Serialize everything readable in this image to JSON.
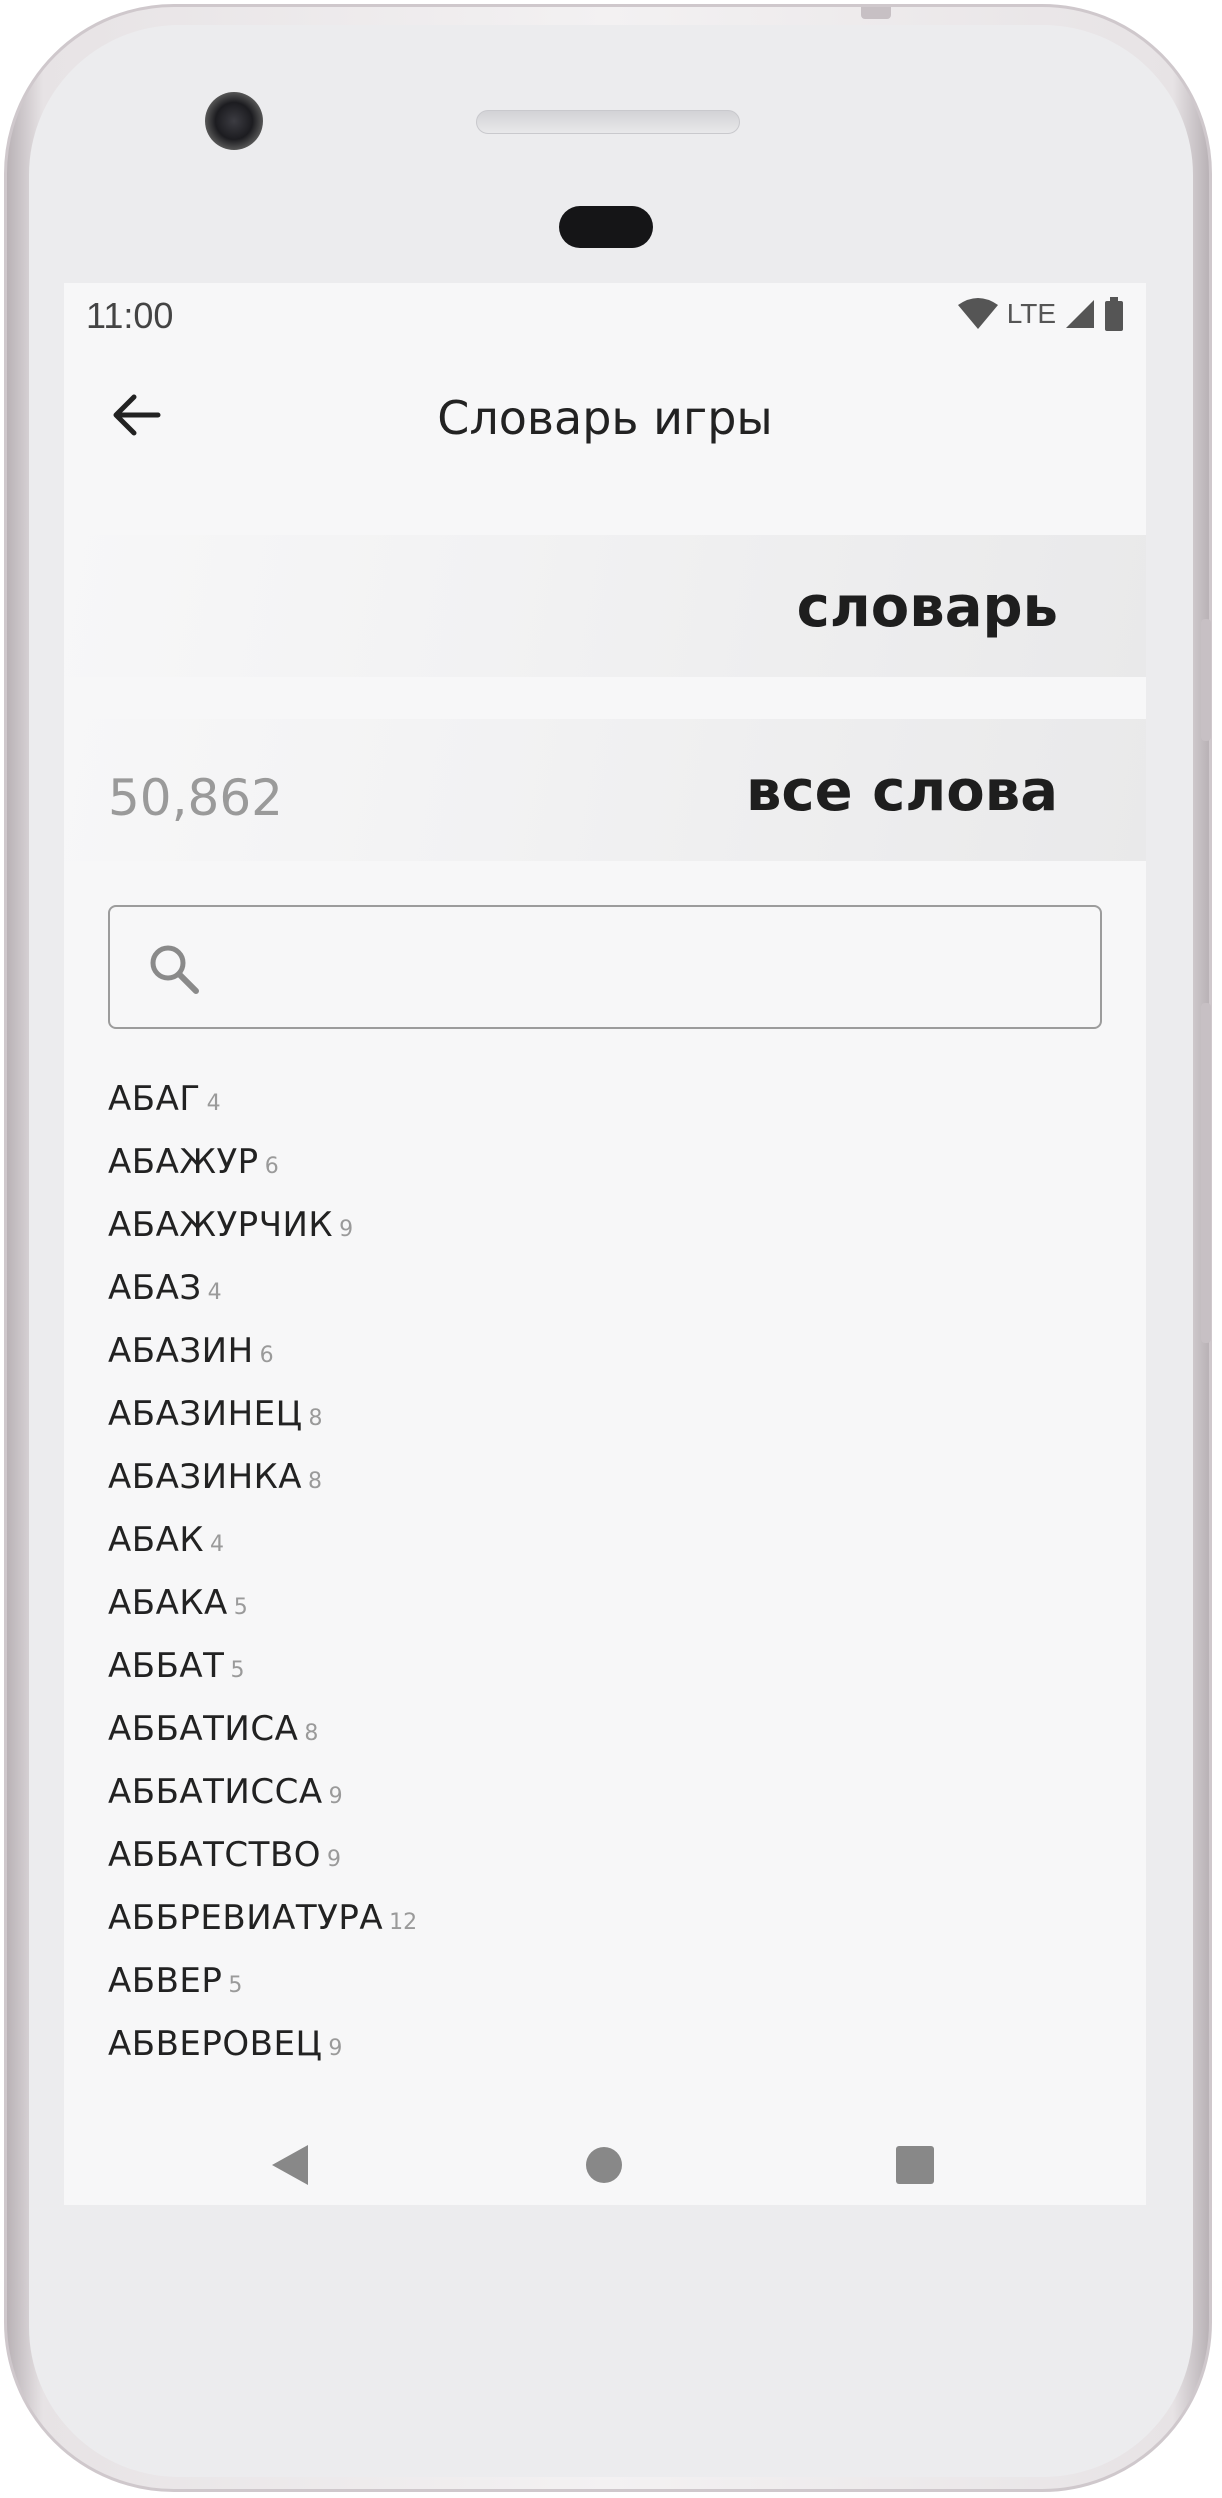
{
  "status_bar": {
    "time": "11:00",
    "network": "LTE",
    "icons": [
      "wifi-icon",
      "signal-icon",
      "battery-icon"
    ]
  },
  "app_bar": {
    "title": "Словарь игры",
    "back_icon": "arrow-back-icon"
  },
  "dictionary_banner": {
    "label": "словарь"
  },
  "all_words_banner": {
    "count": "50,862",
    "label": "все слова"
  },
  "search": {
    "icon": "search-icon",
    "value": "",
    "placeholder": ""
  },
  "words": [
    {
      "word": "АБАГ",
      "length": "4"
    },
    {
      "word": "АБАЖУР",
      "length": "6"
    },
    {
      "word": "АБАЖУРЧИК",
      "length": "9"
    },
    {
      "word": "АБАЗ",
      "length": "4"
    },
    {
      "word": "АБАЗИН",
      "length": "6"
    },
    {
      "word": "АБАЗИНЕЦ",
      "length": "8"
    },
    {
      "word": "АБАЗИНКА",
      "length": "8"
    },
    {
      "word": "АБАК",
      "length": "4"
    },
    {
      "word": "АБАКА",
      "length": "5"
    },
    {
      "word": "АББАТ",
      "length": "5"
    },
    {
      "word": "АББАТИСА",
      "length": "8"
    },
    {
      "word": "АББАТИССА",
      "length": "9"
    },
    {
      "word": "АББАТСТВО",
      "length": "9"
    },
    {
      "word": "АББРЕВИАТУРА",
      "length": "12"
    },
    {
      "word": "АБВЕР",
      "length": "5"
    },
    {
      "word": "АБВЕРОВЕЦ",
      "length": "9"
    }
  ],
  "nav_bar": {
    "icons": [
      "nav-back-icon",
      "nav-home-icon",
      "nav-recent-icon"
    ]
  },
  "colors": {
    "screen_background": "#f7f7f8",
    "text_primary": "#222222",
    "text_secondary": "#9a9a9a",
    "banner_gradient_end": "#e9e9ea"
  }
}
